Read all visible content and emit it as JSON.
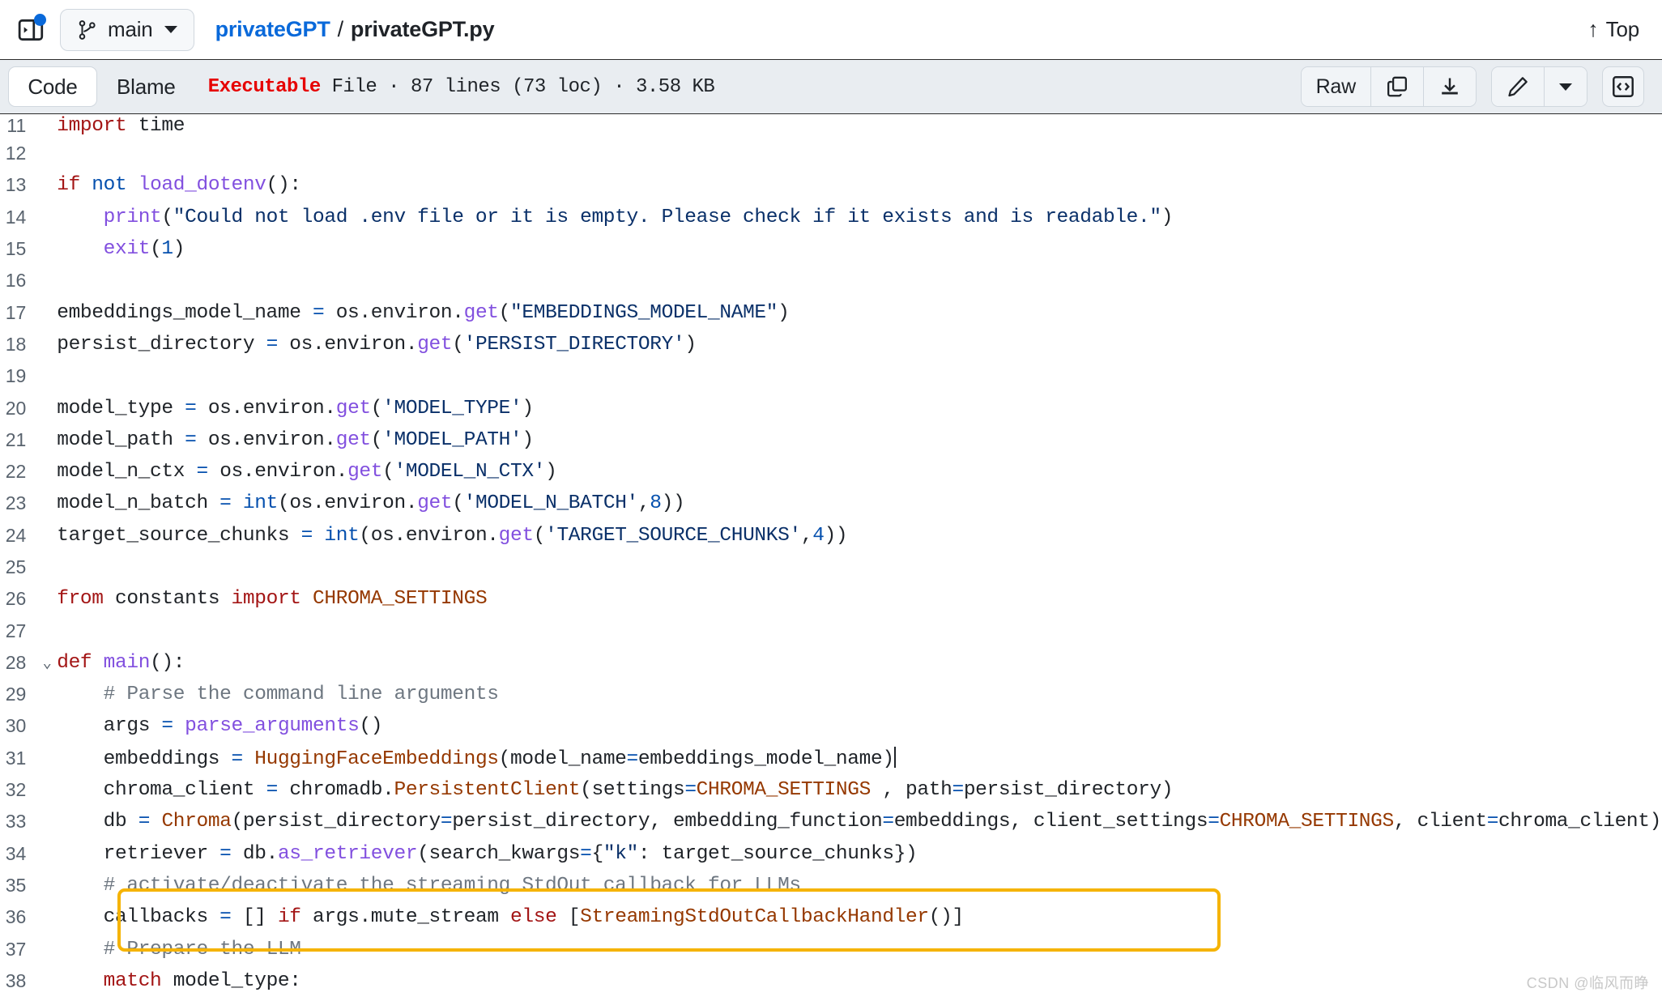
{
  "header": {
    "sidebar_toggle_icon": "sidebar-expand-icon",
    "branch": "main",
    "branch_icon": "git-branch-icon",
    "breadcrumb": {
      "repo": "privateGPT",
      "separator": "/",
      "file": "privateGPT.py"
    },
    "top_label": "Top",
    "top_icon": "arrow-up-icon"
  },
  "toolbar": {
    "tab_code": "Code",
    "tab_blame": "Blame",
    "file_meta": {
      "executable": "Executable",
      "rest": " File · 87 lines (73 loc) · 3.58 KB"
    },
    "raw_label": "Raw",
    "copy_icon": "copy-icon",
    "download_icon": "download-icon",
    "edit_icon": "pencil-icon",
    "edit_caret_icon": "chevron-down-icon",
    "symbols_icon": "code-brackets-icon"
  },
  "code": {
    "lines": [
      {
        "n": "11",
        "fold": ""
      },
      {
        "n": "12",
        "fold": ""
      },
      {
        "n": "13",
        "fold": ""
      },
      {
        "n": "14",
        "fold": ""
      },
      {
        "n": "15",
        "fold": ""
      },
      {
        "n": "16",
        "fold": ""
      },
      {
        "n": "17",
        "fold": ""
      },
      {
        "n": "18",
        "fold": ""
      },
      {
        "n": "19",
        "fold": ""
      },
      {
        "n": "20",
        "fold": ""
      },
      {
        "n": "21",
        "fold": ""
      },
      {
        "n": "22",
        "fold": ""
      },
      {
        "n": "23",
        "fold": ""
      },
      {
        "n": "24",
        "fold": ""
      },
      {
        "n": "25",
        "fold": ""
      },
      {
        "n": "26",
        "fold": ""
      },
      {
        "n": "27",
        "fold": ""
      },
      {
        "n": "28",
        "fold": "⌄"
      },
      {
        "n": "29",
        "fold": ""
      },
      {
        "n": "30",
        "fold": ""
      },
      {
        "n": "31",
        "fold": ""
      },
      {
        "n": "32",
        "fold": ""
      },
      {
        "n": "33",
        "fold": ""
      },
      {
        "n": "34",
        "fold": ""
      },
      {
        "n": "35",
        "fold": ""
      },
      {
        "n": "36",
        "fold": ""
      },
      {
        "n": "37",
        "fold": ""
      },
      {
        "n": "38",
        "fold": ""
      }
    ],
    "text": {
      "l11": "import time",
      "l12": "",
      "l13": "if not load_dotenv():",
      "l14": "    print(\"Could not load .env file or it is empty. Please check if it exists and is readable.\")",
      "l15": "    exit(1)",
      "l16": "",
      "l17": "embeddings_model_name = os.environ.get(\"EMBEDDINGS_MODEL_NAME\")",
      "l18": "persist_directory = os.environ.get('PERSIST_DIRECTORY')",
      "l19": "",
      "l20": "model_type = os.environ.get('MODEL_TYPE')",
      "l21": "model_path = os.environ.get('MODEL_PATH')",
      "l22": "model_n_ctx = os.environ.get('MODEL_N_CTX')",
      "l23": "model_n_batch = int(os.environ.get('MODEL_N_BATCH',8))",
      "l24": "target_source_chunks = int(os.environ.get('TARGET_SOURCE_CHUNKS',4))",
      "l25": "",
      "l26": "from constants import CHROMA_SETTINGS",
      "l27": "",
      "l28": "def main():",
      "l29": "    # Parse the command line arguments",
      "l30": "    args = parse_arguments()",
      "l31": "    embeddings = HuggingFaceEmbeddings(model_name=embeddings_model_name)",
      "l32": "    chroma_client = chromadb.PersistentClient(settings=CHROMA_SETTINGS , path=persist_directory)",
      "l33": "    db = Chroma(persist_directory=persist_directory, embedding_function=embeddings, client_settings=CHROMA_SETTINGS, client=chroma_client)",
      "l34": "    retriever = db.as_retriever(search_kwargs={\"k\": target_source_chunks})",
      "l35": "    # activate/deactivate the streaming StdOut callback for LLMs",
      "l36": "    callbacks = [] if args.mute_stream else [StreamingStdOutCallbackHandler()]",
      "l37": "    # Prepare the LLM",
      "l38": "    match model_type:"
    }
  },
  "highlight": {
    "color": "#f5b301",
    "lines": "32-33"
  },
  "watermark": "CSDN @临风而睁"
}
